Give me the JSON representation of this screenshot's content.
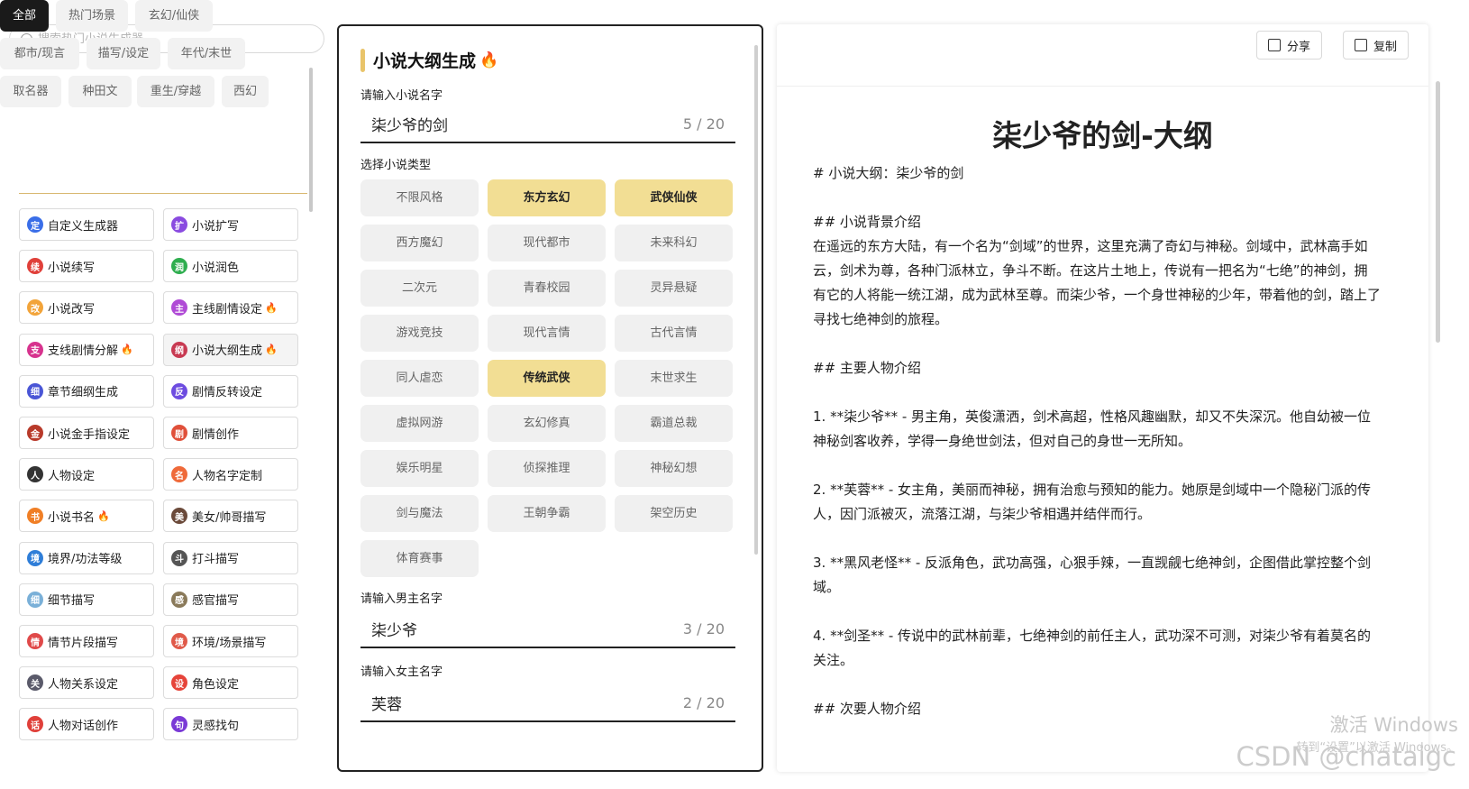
{
  "search": {
    "placeholder": "搜索热门小说生成器"
  },
  "categories": [
    "全部",
    "热门场景",
    "玄幻/仙侠",
    "都市/现言",
    "描写/设定",
    "年代/末世",
    "取名器",
    "种田文",
    "重生/穿越",
    "西幻"
  ],
  "tools": [
    {
      "label": "自定义生成器",
      "icon": "定",
      "color": "#3a6ee8",
      "hot": false
    },
    {
      "label": "小说扩写",
      "icon": "扩",
      "color": "#8a4be0",
      "hot": false
    },
    {
      "label": "小说续写",
      "icon": "续",
      "color": "#e0403a",
      "hot": false
    },
    {
      "label": "小说润色",
      "icon": "润",
      "color": "#2fae4f",
      "hot": false
    },
    {
      "label": "小说改写",
      "icon": "改",
      "color": "#f2a43a",
      "hot": false
    },
    {
      "label": "主线剧情设定",
      "icon": "主",
      "color": "#b04bd6",
      "hot": true
    },
    {
      "label": "支线剧情分解",
      "icon": "支",
      "color": "#d7338e",
      "hot": true
    },
    {
      "label": "小说大纲生成",
      "icon": "纲",
      "color": "#c83a52",
      "hot": true
    },
    {
      "label": "章节细纲生成",
      "icon": "细",
      "color": "#4a56d6",
      "hot": false
    },
    {
      "label": "剧情反转设定",
      "icon": "反",
      "color": "#6d4ce0",
      "hot": false
    },
    {
      "label": "小说金手指设定",
      "icon": "金",
      "color": "#b83a2a",
      "hot": false
    },
    {
      "label": "剧情创作",
      "icon": "剧",
      "color": "#e0503a",
      "hot": false
    },
    {
      "label": "人物设定",
      "icon": "人",
      "color": "#333333",
      "hot": false
    },
    {
      "label": "人物名字定制",
      "icon": "名",
      "color": "#ef6a3a",
      "hot": false
    },
    {
      "label": "小说书名",
      "icon": "书",
      "color": "#f07f26",
      "hot": true
    },
    {
      "label": "美女/帅哥描写",
      "icon": "美",
      "color": "#6b4a3a",
      "hot": false
    },
    {
      "label": "境界/功法等级",
      "icon": "境",
      "color": "#2f7ed8",
      "hot": false
    },
    {
      "label": "打斗描写",
      "icon": "斗",
      "color": "#555555",
      "hot": false
    },
    {
      "label": "细节描写",
      "icon": "细",
      "color": "#7ab0d8",
      "hot": false
    },
    {
      "label": "感官描写",
      "icon": "感",
      "color": "#8a7a5a",
      "hot": false
    },
    {
      "label": "情节片段描写",
      "icon": "情",
      "color": "#e04a4a",
      "hot": false
    },
    {
      "label": "环境/场景描写",
      "icon": "境",
      "color": "#e05a4a",
      "hot": false
    },
    {
      "label": "人物关系设定",
      "icon": "关",
      "color": "#5a5a6a",
      "hot": false
    },
    {
      "label": "角色设定",
      "icon": "设",
      "color": "#e6443a",
      "hot": false
    },
    {
      "label": "人物对话创作",
      "icon": "话",
      "color": "#e0403a",
      "hot": false
    },
    {
      "label": "灵感找句",
      "icon": "句",
      "color": "#7a3ad6",
      "hot": false
    }
  ],
  "form": {
    "title": "小说大纲生成",
    "name_label": "请输入小说名字",
    "name_value": "柒少爷的剑",
    "name_count": "5 / 20",
    "type_label": "选择小说类型",
    "genres": [
      {
        "label": "不限风格",
        "selected": false
      },
      {
        "label": "东方玄幻",
        "selected": true
      },
      {
        "label": "武侠仙侠",
        "selected": true
      },
      {
        "label": "西方魔幻",
        "selected": false
      },
      {
        "label": "现代都市",
        "selected": false
      },
      {
        "label": "未来科幻",
        "selected": false
      },
      {
        "label": "二次元",
        "selected": false
      },
      {
        "label": "青春校园",
        "selected": false
      },
      {
        "label": "灵异悬疑",
        "selected": false
      },
      {
        "label": "游戏竞技",
        "selected": false
      },
      {
        "label": "现代言情",
        "selected": false
      },
      {
        "label": "古代言情",
        "selected": false
      },
      {
        "label": "同人虐恋",
        "selected": false
      },
      {
        "label": "传统武侠",
        "selected": true
      },
      {
        "label": "末世求生",
        "selected": false
      },
      {
        "label": "虚拟网游",
        "selected": false
      },
      {
        "label": "玄幻修真",
        "selected": false
      },
      {
        "label": "霸道总裁",
        "selected": false
      },
      {
        "label": "娱乐明星",
        "selected": false
      },
      {
        "label": "侦探推理",
        "selected": false
      },
      {
        "label": "神秘幻想",
        "selected": false
      },
      {
        "label": "剑与魔法",
        "selected": false
      },
      {
        "label": "王朝争霸",
        "selected": false
      },
      {
        "label": "架空历史",
        "selected": false
      },
      {
        "label": "体育赛事",
        "selected": false
      }
    ],
    "male_label": "请输入男主名字",
    "male_value": "柒少爷",
    "male_count": "3 / 20",
    "female_label": "请输入女主名字",
    "female_value": "芙蓉",
    "female_count": "2 / 20"
  },
  "output": {
    "share_label": "分享",
    "copy_label": "复制",
    "title": "柒少爷的剑-大纲",
    "paragraphs": [
      "# 小说大纲：柒少爷的剑",
      "",
      "## 小说背景介绍",
      "在遥远的东方大陆，有一个名为“剑域”的世界，这里充满了奇幻与神秘。剑域中，武林高手如云，剑术为尊，各种门派林立，争斗不断。在这片土地上，传说有一把名为“七绝”的神剑，拥有它的人将能一统江湖，成为武林至尊。而柒少爷，一个身世神秘的少年，带着他的剑，踏上了寻找七绝神剑的旅程。",
      "",
      "## 主要人物介绍",
      "",
      "1. **柒少爷** - 男主角，英俊潇洒，剑术高超，性格风趣幽默，却又不失深沉。他自幼被一位神秘剑客收养，学得一身绝世剑法，但对自己的身世一无所知。",
      "",
      "2. **芙蓉** - 女主角，美丽而神秘，拥有治愈与预知的能力。她原是剑域中一个隐秘门派的传人，因门派被灭，流落江湖，与柒少爷相遇并结伴而行。",
      "",
      "3. **黑风老怪** - 反派角色，武功高强，心狠手辣，一直觊觎七绝神剑，企图借此掌控整个剑域。",
      "",
      "4. **剑圣** - 传说中的武林前辈，七绝神剑的前任主人，武功深不可测，对柒少爷有着莫名的关注。",
      "",
      "## 次要人物介绍"
    ]
  },
  "watermark": {
    "line1": "激活 Windows",
    "line2": "转到“设置”以激活 Windows。",
    "csdn": "CSDN @chataigc"
  }
}
